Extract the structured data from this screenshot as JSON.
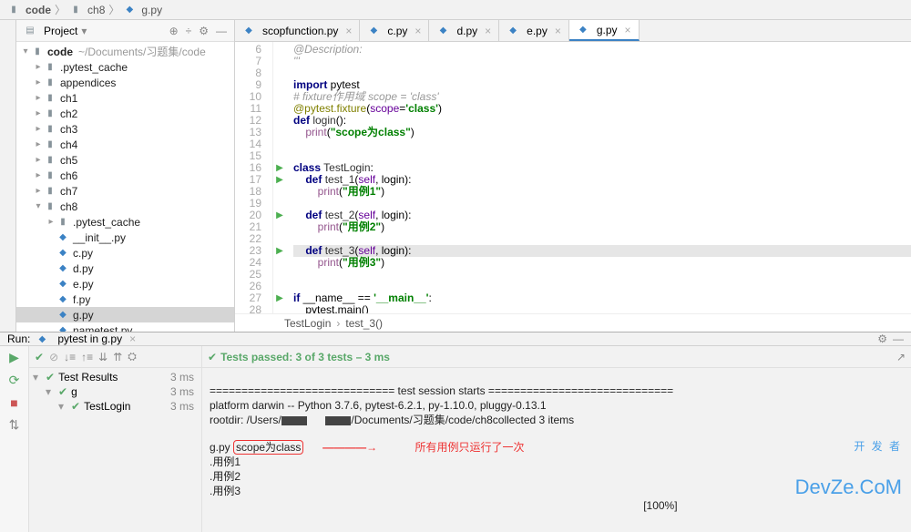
{
  "breadcrumb": [
    "code",
    "ch8",
    "g.py"
  ],
  "sidebar": {
    "title": "Project",
    "root": {
      "name": "code",
      "hint": "~/Documents/习题集/code"
    },
    "folders": [
      ".pytest_cache",
      "appendices",
      "ch1",
      "ch2",
      "ch3",
      "ch4",
      "ch5",
      "ch6",
      "ch7"
    ],
    "open_folder": "ch8",
    "open_subfolder": ".pytest_cache",
    "files": [
      "__init__.py",
      "c.py",
      "d.py",
      "e.py",
      "f.py",
      "g.py",
      "nametest.py"
    ],
    "selected_file": "g.py"
  },
  "tabs": [
    "scopfunction.py",
    "c.py",
    "d.py",
    "e.py",
    "g.py"
  ],
  "active_tab": "g.py",
  "code_start_line": 6,
  "code_lines": [
    {
      "n": 6,
      "html": "<span class='c'>@Description:</span>"
    },
    {
      "n": 7,
      "html": "<span class='c'>'''</span>"
    },
    {
      "n": 8,
      "html": ""
    },
    {
      "n": 9,
      "html": "<span class='k'>import</span> pytest"
    },
    {
      "n": 10,
      "html": "<span class='c'># fixture作用域 scope = 'class'</span>"
    },
    {
      "n": 11,
      "html": "<span class='d'>@pytest.fixture</span>(<span class='p'>scope</span>=<span class='s'>'class'</span>)"
    },
    {
      "n": 12,
      "html": "<span class='k'>def</span> <span class='f'>login</span>():"
    },
    {
      "n": 13,
      "html": "    <span class='sl'>print</span>(<span class='s'>\"scope为class\"</span>)"
    },
    {
      "n": 14,
      "html": ""
    },
    {
      "n": 15,
      "html": ""
    },
    {
      "n": 16,
      "mark": "▶",
      "html": "<span class='k'>class</span> <span class='f'>TestLogin</span>:"
    },
    {
      "n": 17,
      "mark": "▶",
      "html": "    <span class='k'>def</span> <span class='f'>test_1</span>(<span class='p'>self</span>, login):"
    },
    {
      "n": 18,
      "html": "        <span class='sl'>print</span>(<span class='s'>\"用例1\"</span>)"
    },
    {
      "n": 19,
      "html": ""
    },
    {
      "n": 20,
      "mark": "▶",
      "html": "    <span class='k'>def</span> <span class='f'>test_2</span>(<span class='p'>self</span>, login):"
    },
    {
      "n": 21,
      "html": "        <span class='sl'>print</span>(<span class='s'>\"用例2\"</span>)"
    },
    {
      "n": 22,
      "html": ""
    },
    {
      "n": 23,
      "mark": "▶",
      "hl": true,
      "html": "    <span class='k'>def</span> <span class='f'>test_3</span>(<span class='p'>self</span>, login):"
    },
    {
      "n": 24,
      "html": "        <span class='sl'>print</span>(<span class='s'>\"用例3\"</span>)"
    },
    {
      "n": 25,
      "html": ""
    },
    {
      "n": 26,
      "html": ""
    },
    {
      "n": 27,
      "mark": "▶",
      "html": "<span class='k'>if</span> __name__ == <span class='s'>'__main__'</span>:"
    },
    {
      "n": 28,
      "html": "    pytest.main()"
    }
  ],
  "code_crumb": [
    "TestLogin",
    "test_3()"
  ],
  "run": {
    "label": "Run:",
    "config": "pytest in g.py",
    "status": "Tests passed: 3 of 3 tests – 3 ms",
    "root_label": "Test Results",
    "root_time": "3 ms",
    "nodes": [
      {
        "name": "g",
        "time": "3 ms",
        "indent": 1
      },
      {
        "name": "TestLogin",
        "time": "3 ms",
        "indent": 2
      }
    ]
  },
  "console": {
    "line1": "============================= test session starts =============================",
    "line2": "platform darwin -- Python 3.7.6, pytest-6.2.1, py-1.10.0, pluggy-0.13.1",
    "line3a": "rootdir: /Users/",
    "line3b": "/Documents/习题集/code/ch8collected 3 items",
    "line4a": "g.py ",
    "box": "scope为class",
    "note": "所有用例只运行了一次",
    "line5": ".用例1",
    "line6": ".用例2",
    "line7": ".用例3",
    "pct": "[100%]"
  },
  "watermark": {
    "zh": "开 发 者",
    "en": "DevZe.CoM"
  }
}
